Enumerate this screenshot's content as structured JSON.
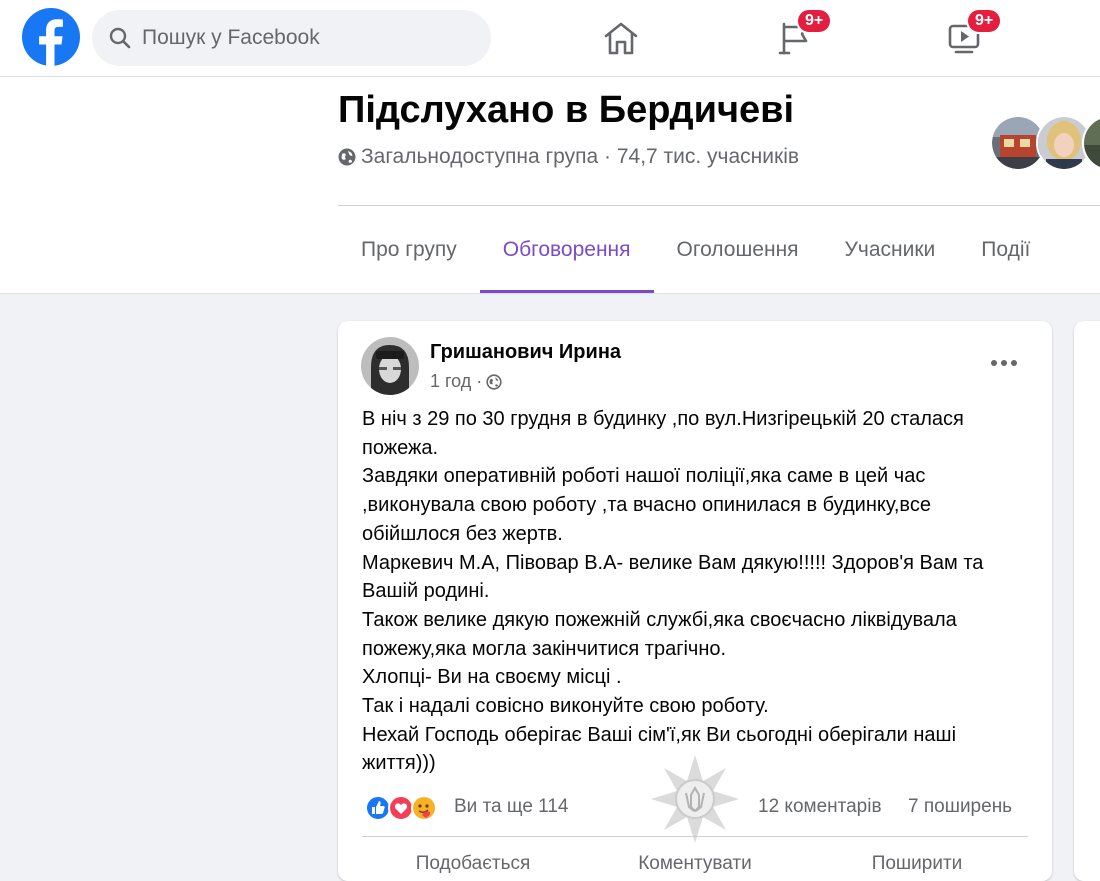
{
  "topbar": {
    "logo": "facebook-logo",
    "search_placeholder": "Пошук у Facebook",
    "nav": [
      {
        "name": "home",
        "icon": "home-icon"
      },
      {
        "name": "pages",
        "icon": "flag-icon",
        "badge": "9+"
      },
      {
        "name": "watch",
        "icon": "video-icon",
        "badge": "9+"
      }
    ]
  },
  "group": {
    "title": "Підслухано в Бердичеві",
    "meta": "Загальнодоступна група · 74,7 тис. учасників",
    "tabs": [
      "Про групу",
      "Обговорення",
      "Оголошення",
      "Учасники",
      "Події"
    ],
    "active_tab_index": 1
  },
  "post": {
    "author": "Гришанович Ирина",
    "time": "1 год ·",
    "lines": [
      "В ніч з 29 по 30 грудня в будинку ,по вул.Низгірецькій 20 сталася",
      "пожежа.",
      "Завдяки оперативній роботі нашої поліції,яка саме в цей час",
      ",виконувала свою роботу ,та вчасно опинилася  в будинку,все",
      "обійшлося без жертв.",
      "Маркевич М.А, Півовар В.А- велике Вам дякую!!!!! Здоров'я Вам та",
      "Вашій родині.",
      "Також велике дякую пожежній службі,яка своєчасно ліквідувала",
      "пожежу,яка могла закінчитися трагічно.",
      "Хлопці- Ви на своєму місці .",
      "Так і надалі совісно виконуйте свою роботу.",
      "Нехай Господь оберігає Ваші сім'ї,як Ви сьогодні оберігали наші",
      "життя)))"
    ],
    "reactions_text": "Ви та ще 114",
    "comments": "12 коментарів",
    "shares": "7 поширень",
    "actions": [
      "Подобається",
      "Коментувати",
      "Поширити"
    ]
  },
  "colors": {
    "accent": "#7a4bc9",
    "facebook_blue": "#1877f2",
    "badge_red": "#e41e3f",
    "secondary_text": "#65676b"
  }
}
